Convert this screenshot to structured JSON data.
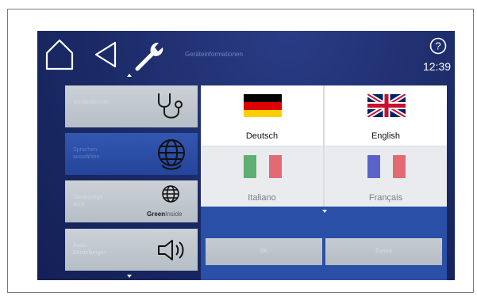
{
  "topbar": {
    "title": "Geräteinformationen",
    "time": "12:39",
    "help_symbol": "?",
    "icons": [
      "home-icon",
      "back-triangle-icon",
      "wrench-icon",
      "help-circle-icon"
    ]
  },
  "menu": {
    "items": [
      {
        "label": "Gerätedienste",
        "icon": "stethoscope-icon",
        "active": false
      },
      {
        "label": "Sprachen\nauswählen",
        "icon": "globe-icon",
        "active": true
      },
      {
        "label": "Ökoanzeige\nAUS",
        "icon": "globe-icon",
        "badge_bold": "Green",
        "badge_rest": "Inside",
        "active": false
      },
      {
        "label": "Audio\nEinstellungen",
        "icon": "speaker-icon",
        "active": false
      }
    ]
  },
  "languages": [
    {
      "label": "Deutsch",
      "flag": "de-flag",
      "selectable": true
    },
    {
      "label": "English",
      "flag": "uk-flag",
      "selectable": true
    },
    {
      "label": "Italiano",
      "flag": "it-flag",
      "selectable": false
    },
    {
      "label": "Français",
      "flag": "fr-flag",
      "selectable": false
    }
  ],
  "actions": {
    "ok_label": "OK",
    "back_label": "Zurück"
  },
  "colors": {
    "background": "#1b2a66",
    "active_item": "#2b4ea8",
    "inactive_item": "#c3c9cf",
    "flag_de": [
      "#000000",
      "#dd0000",
      "#ffce00"
    ],
    "flag_it": [
      "#009246",
      "#ffffff",
      "#ce2b37"
    ],
    "flag_fr": [
      "#0055a4",
      "#ffffff",
      "#ef4135"
    ]
  }
}
